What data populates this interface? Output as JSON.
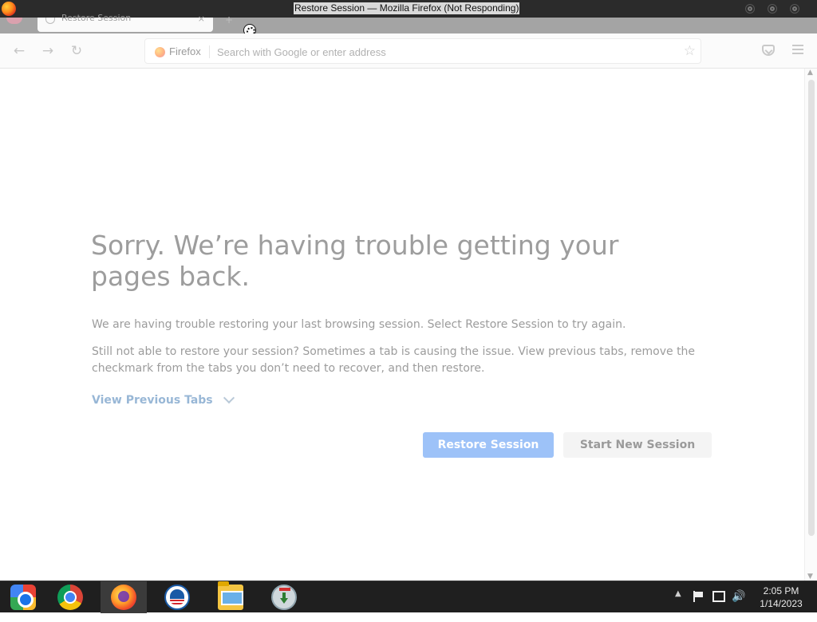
{
  "window": {
    "title": "Restore Session — Mozilla Firefox (Not Responding)"
  },
  "tabs": [
    {
      "label": "Restore Session",
      "active": true,
      "close": "×"
    }
  ],
  "toolbar": {
    "new_tab": "+",
    "back": "←",
    "forward": "→",
    "reload": "↻",
    "identity_label": "Firefox",
    "url_value": "",
    "url_placeholder": "Search with Google or enter address",
    "bookmark_star": "☆"
  },
  "page": {
    "title": "Sorry. We’re having trouble getting your pages back.",
    "paragraph1": "We are having trouble restoring your last browsing session. Select Restore Session to try again.",
    "paragraph2": "Still not able to restore your session? Sometimes a tab is causing the issue. View previous tabs, remove the checkmark from the tabs you don’t need to recover, and then restore.",
    "view_previous_tabs": "View Previous Tabs",
    "restore_button": "Restore Session",
    "new_session_button": "Start New Session"
  },
  "scrollbar": {
    "up": "▲",
    "down": "▼"
  },
  "taskbar": {
    "apps": [
      {
        "name": "start-menu",
        "active": false
      },
      {
        "name": "chrome",
        "active": false
      },
      {
        "name": "firefox",
        "active": true
      },
      {
        "name": "campaign-app",
        "active": false
      },
      {
        "name": "file-explorer",
        "active": false
      },
      {
        "name": "installer",
        "active": false
      }
    ],
    "tray_chevron": "▲",
    "volume": "🔊",
    "time": "2:05 PM",
    "date": "1/14/2023"
  },
  "colors": {
    "primary_button": "#9dc2f8",
    "link": "#98b7d6",
    "taskbar": "#1f1f1f"
  }
}
